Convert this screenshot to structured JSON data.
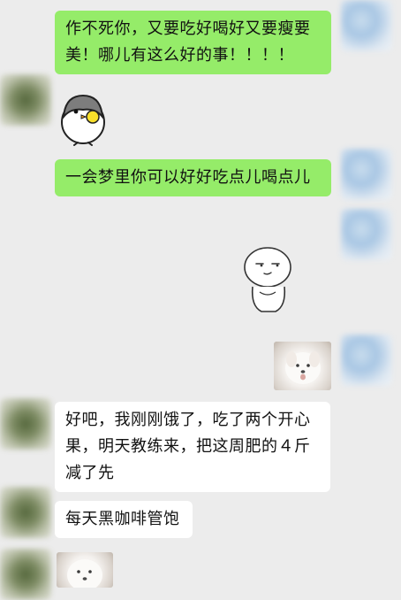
{
  "messages": {
    "m1": "作不死你，又要吃好喝好又要瘦要美！哪儿有这么好的事！！！！",
    "m2": "一会梦里你可以好好吃点儿喝点儿",
    "m3": "好吧，我刚刚饿了，吃了两个开心果，明天教练来，把这周肥的４斤减了先",
    "m4": "每天黑咖啡管饱"
  },
  "colors": {
    "chat_background": "#ececec",
    "outgoing_bubble": "#95ec69",
    "incoming_bubble": "#ffffff"
  },
  "icons": {
    "sticker_penguin": "penguin-eating-sticker",
    "sticker_bun": "smirking-bun-sticker",
    "photo_dog": "white-dog-photo"
  }
}
